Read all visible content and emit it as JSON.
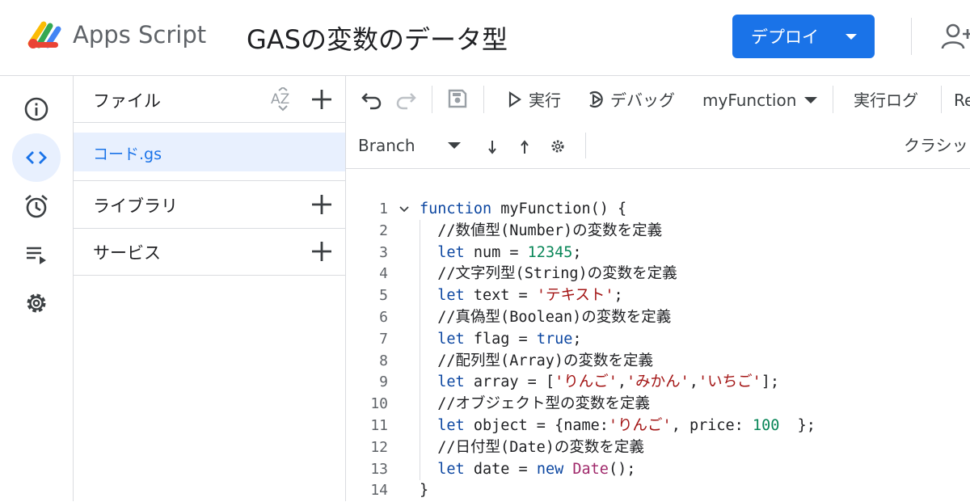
{
  "header": {
    "app_name": "Apps Script",
    "project_title": "GASの変数のデータ型",
    "deploy_label": "デプロイ"
  },
  "files_panel": {
    "files_label": "ファイル",
    "sort_label": "AZ",
    "files": [
      "コード.gs"
    ],
    "libraries_label": "ライブラリ",
    "services_label": "サービス"
  },
  "toolbar": {
    "run_label": "実行",
    "debug_label": "デバッグ",
    "function_name": "myFunction",
    "execution_log_label": "実行ログ",
    "truncated_label": "Re",
    "branch_label": "Branch",
    "classic_label": "クラシッ"
  },
  "icons": {
    "rail": [
      "info-icon",
      "code-icon",
      "alarm-clock-icon",
      "executions-icon",
      "settings-icon"
    ],
    "toolbar": [
      "undo-icon",
      "redo-icon",
      "save-icon",
      "play-icon",
      "debug-icon",
      "arrow-down-icon",
      "arrow-up-icon",
      "gear-icon"
    ],
    "header": [
      "apps-script-logo",
      "add-person-icon"
    ]
  },
  "colors": {
    "accent": "#1a73e8",
    "active_nav_bg": "#e8f0fe",
    "keyword": "#0d47a1",
    "string": "#a31515",
    "number": "#098658"
  },
  "code": {
    "line_numbers": [
      "1",
      "2",
      "3",
      "4",
      "5",
      "6",
      "7",
      "8",
      "9",
      "10",
      "11",
      "12",
      "13",
      "14"
    ],
    "lines": [
      [
        {
          "t": "kw",
          "v": "function"
        },
        {
          "t": "",
          "v": " myFunction() {"
        }
      ],
      [
        {
          "t": "cm",
          "v": "  //数値型(Number)の変数を定義"
        }
      ],
      [
        {
          "t": "kw",
          "v": "  let"
        },
        {
          "t": "",
          "v": " num = "
        },
        {
          "t": "num",
          "v": "12345"
        },
        {
          "t": "",
          "v": ";"
        }
      ],
      [
        {
          "t": "cm",
          "v": "  //文字列型(String)の変数を定義"
        }
      ],
      [
        {
          "t": "kw",
          "v": "  let"
        },
        {
          "t": "",
          "v": " text = "
        },
        {
          "t": "str",
          "v": "'テキスト'"
        },
        {
          "t": "",
          "v": ";"
        }
      ],
      [
        {
          "t": "cm",
          "v": "  //真偽型(Boolean)の変数を定義"
        }
      ],
      [
        {
          "t": "kw",
          "v": "  let"
        },
        {
          "t": "",
          "v": " flag = "
        },
        {
          "t": "kw",
          "v": "true"
        },
        {
          "t": "",
          "v": ";"
        }
      ],
      [
        {
          "t": "cm",
          "v": "  //配列型(Array)の変数を定義"
        }
      ],
      [
        {
          "t": "kw",
          "v": "  let"
        },
        {
          "t": "",
          "v": " array = ["
        },
        {
          "t": "str",
          "v": "'りんご'"
        },
        {
          "t": "",
          "v": ","
        },
        {
          "t": "str",
          "v": "'みかん'"
        },
        {
          "t": "",
          "v": ","
        },
        {
          "t": "str",
          "v": "'いちご'"
        },
        {
          "t": "",
          "v": "];"
        }
      ],
      [
        {
          "t": "cm",
          "v": "  //オブジェクト型の変数を定義"
        }
      ],
      [
        {
          "t": "kw",
          "v": "  let"
        },
        {
          "t": "",
          "v": " object = {name:"
        },
        {
          "t": "str",
          "v": "'りんご'"
        },
        {
          "t": "",
          "v": ", price: "
        },
        {
          "t": "num",
          "v": "100"
        },
        {
          "t": "",
          "v": "  };"
        }
      ],
      [
        {
          "t": "cm",
          "v": "  //日付型(Date)の変数を定義"
        }
      ],
      [
        {
          "t": "kw",
          "v": "  let"
        },
        {
          "t": "",
          "v": " date = "
        },
        {
          "t": "kw",
          "v": "new"
        },
        {
          "t": "",
          "v": " "
        },
        {
          "t": "kwr",
          "v": "Date"
        },
        {
          "t": "",
          "v": "();"
        }
      ],
      [
        {
          "t": "",
          "v": "}"
        }
      ]
    ]
  }
}
